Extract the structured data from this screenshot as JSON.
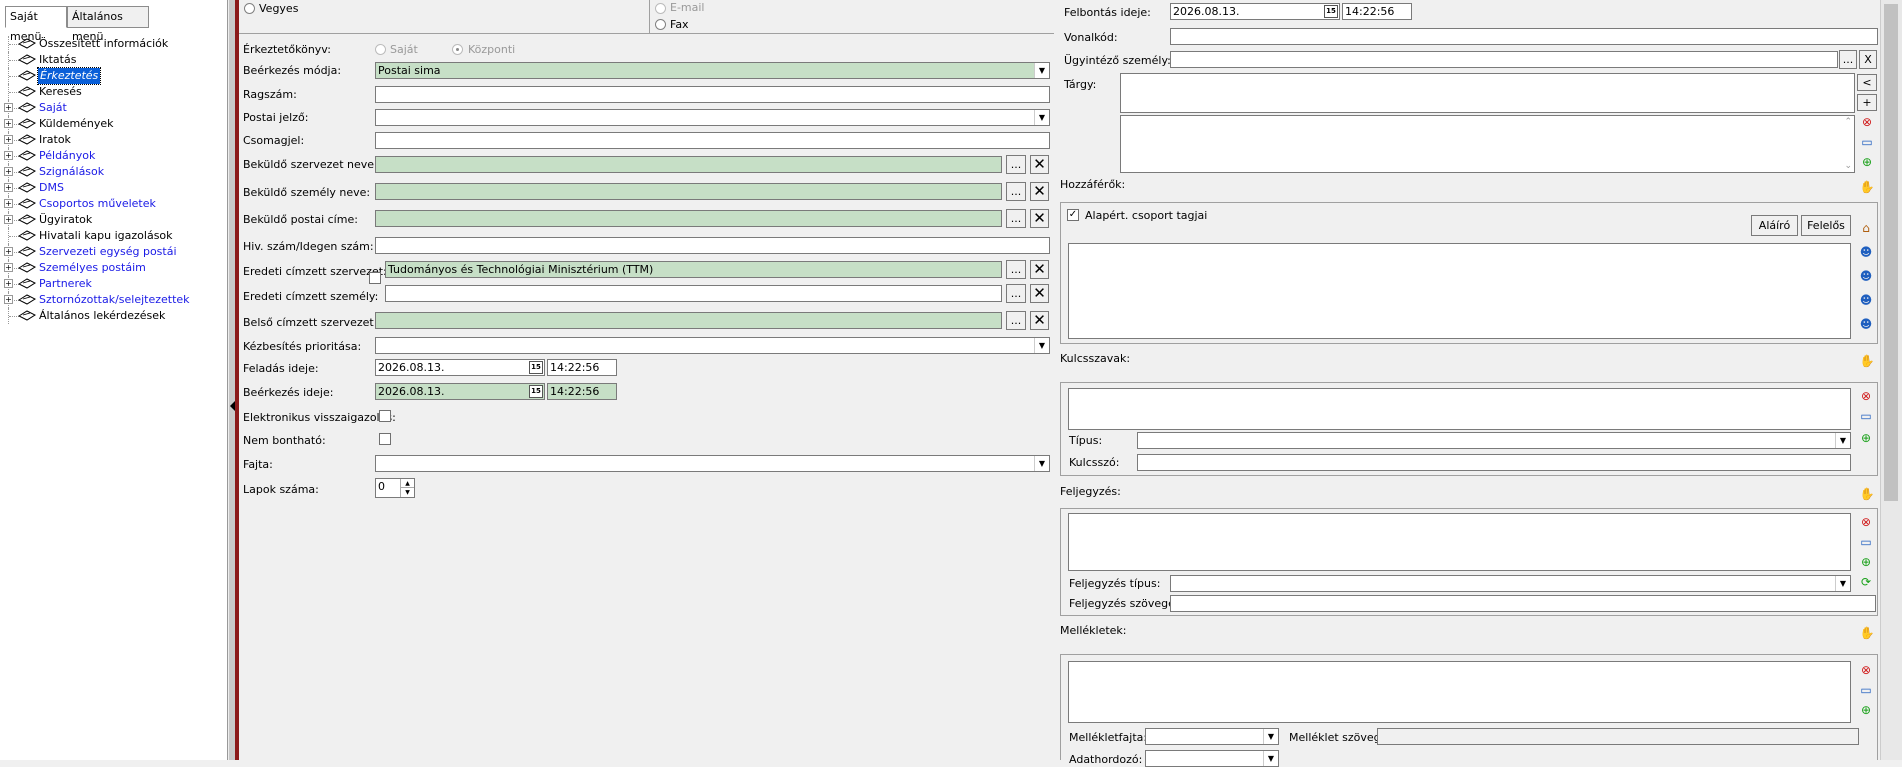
{
  "left": {
    "tabs": [
      "Saját menü",
      "Általános menü"
    ],
    "tree": [
      {
        "label": "Összesített információk",
        "expand": false,
        "link": false
      },
      {
        "label": "Iktatás",
        "expand": false,
        "link": false
      },
      {
        "label": "Érkeztetés",
        "expand": false,
        "link": true,
        "selected": true
      },
      {
        "label": "Keresés",
        "expand": false,
        "link": false
      },
      {
        "label": "Saját",
        "expand": true,
        "link": true
      },
      {
        "label": "Küldemények",
        "expand": true,
        "link": false
      },
      {
        "label": "Iratok",
        "expand": true,
        "link": false
      },
      {
        "label": "Példányok",
        "expand": true,
        "link": true
      },
      {
        "label": "Szignálások",
        "expand": true,
        "link": true
      },
      {
        "label": "DMS",
        "expand": true,
        "link": true
      },
      {
        "label": "Csoportos műveletek",
        "expand": true,
        "link": true
      },
      {
        "label": "Ügyiratok",
        "expand": true,
        "link": false
      },
      {
        "label": "Hivatali kapu igazolások",
        "expand": false,
        "link": false
      },
      {
        "label": "Szervezeti egység postái",
        "expand": true,
        "link": true
      },
      {
        "label": "Személyes postáim",
        "expand": true,
        "link": true
      },
      {
        "label": "Partnerek",
        "expand": true,
        "link": true
      },
      {
        "label": "Sztornózottak/selejtezettek",
        "expand": true,
        "link": true
      },
      {
        "label": "Általános lekérdezések",
        "expand": false,
        "link": false
      }
    ]
  },
  "middle": {
    "top": {
      "vegyes": "Vegyes",
      "email": "E-mail",
      "fax": "Fax"
    },
    "erkezteto_label": "Érkeztetőkönyv:",
    "erkezteto_opt1": "Saját",
    "erkezteto_opt2": "Központi",
    "beerkezes_modja_label": "Beérkezés módja:",
    "beerkezes_modja_value": "Postai sima",
    "ragszam_label": "Ragszám:",
    "postai_jelzo_label": "Postai jelző:",
    "csomagjel_label": "Csomagjel:",
    "bekuldo_szervezet_label": "Beküldő szervezet neve:",
    "bekuldo_szemely_label": "Beküldő személy neve:",
    "bekuldo_postai_label": "Beküldő postai címe:",
    "hiv_szam_label": "Hiv. szám/Idegen szám:",
    "eredeti_szervezet_label": "Eredeti címzett szervezet:",
    "eredeti_szervezet_value": "Tudományos és Technológiai Minisztérium (TTM)",
    "eredeti_szemely_label": "Eredeti címzett személy:",
    "belso_szervezet_label": "Belső címzett szervezet:",
    "kezbesites_label": "Kézbesítés prioritása:",
    "feladas_label": "Feladás ideje:",
    "feladas_date": "2026.08.13.",
    "feladas_time": "14:22:56",
    "beerkezes_ideje_label": "Beérkezés ideje:",
    "beerkezes_date": "2026.08.13.",
    "beerkezes_time": "14:22:56",
    "elektronikus_label": "Elektronikus visszaigazolás:",
    "nem_bonthato_label": "Nem bontható:",
    "fajta_label": "Fajta:",
    "lapok_label": "Lapok száma:",
    "lapok_value": "0",
    "dots": "...",
    "x": "✕"
  },
  "right": {
    "felbontas_label": "Felbontás ideje:",
    "felbontas_date": "2026.08.13.",
    "felbontas_time": "14:22:56",
    "vonalkod_label": "Vonalkód:",
    "ugyintezo_label": "Ügyintéző személy:",
    "targy_label": "Tárgy:",
    "hozzaferok_label": "Hozzáférők:",
    "alapert_label": "Alapért. csoport tagjai",
    "alairo_btn": "Aláíró",
    "felelos_btn": "Felelős",
    "kulcsszavak_label": "Kulcsszavak:",
    "tipus_label": "Típus:",
    "kulcsszo_label": "Kulcsszó:",
    "feljegyzes_label": "Feljegyzés:",
    "feljegyzes_tipus_label": "Feljegyzés típus:",
    "feljegyzes_szovege_label": "Feljegyzés szövege:",
    "mellekletek_label": "Mellékletek:",
    "mellekletfajta_label": "Mellékletfajta:",
    "melleklet_szoveg_label": "Melléklet szöveg:",
    "adathordozo_label": "Adathordozó:",
    "lt": "<",
    "plus": "+",
    "dots": "...",
    "x": "X"
  }
}
